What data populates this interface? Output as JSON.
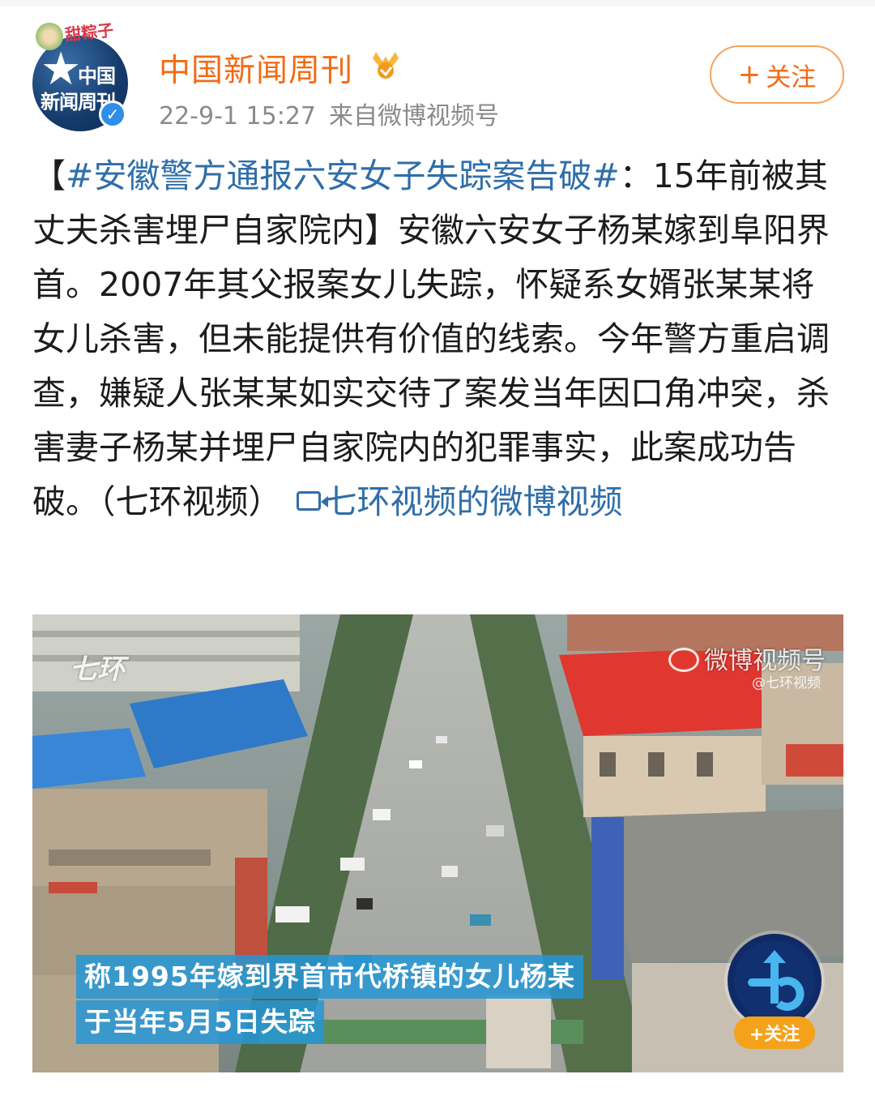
{
  "author": {
    "name": "中国新闻周刊",
    "avatar_text_line1": "中国",
    "avatar_text_line2": "新闻周刊",
    "avatar_sticker": "甜粽子",
    "time": "22-9-1 15:27",
    "source": "来自微博视频号"
  },
  "follow_button": {
    "plus": "+",
    "label": "关注"
  },
  "post": {
    "bracket_open": "【",
    "topic": "#安徽警方通报六安女子失踪案告破#",
    "headline_rest": "：15年前被其丈夫杀害埋尸自家院内】",
    "body": "安徽六安女子杨某嫁到阜阳界首。2007年其父报案女儿失踪，怀疑系女婿张某某将女儿杀害，但未能提供有价值的线索。今年警方重启调查，嫌疑人张某某如实交待了案发当年因口角冲突，杀害妻子杨某并埋尸自家院内的犯罪事实，此案成功告破。（七环视频）",
    "video_link": "七环视频的微博视频"
  },
  "video": {
    "watermark_left": "七环",
    "watermark_right": "微博视频号",
    "watermark_handle": "@七环视频",
    "caption_line1": "称1995年嫁到界首市代桥镇的女儿杨某",
    "caption_line2": "于当年5月5日失踪",
    "channel_follow": "+关注"
  },
  "colors": {
    "author": "#f36b14",
    "topic": "#2f6ea8",
    "meta": "#8a8a8a",
    "caption_bg": "#2496d6"
  }
}
